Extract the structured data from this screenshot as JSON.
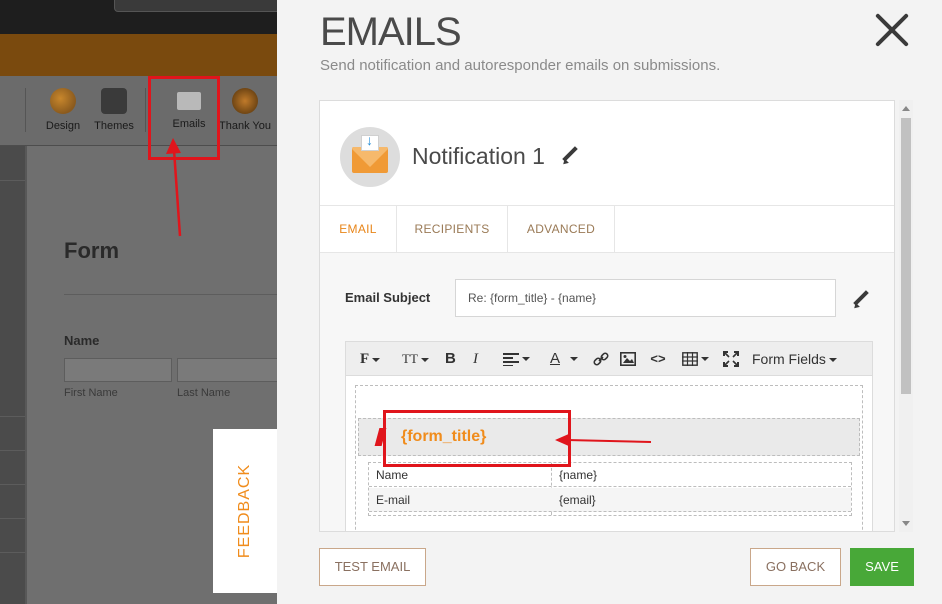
{
  "background_builder": {
    "toolbar": {
      "items": [
        {
          "label": "Design",
          "icon": "palette-icon"
        },
        {
          "label": "Themes",
          "icon": "paint-bucket-icon"
        },
        {
          "label": "Emails",
          "icon": "email-icon"
        },
        {
          "label": "Thank You",
          "icon": "thank-you-icon"
        }
      ]
    },
    "form": {
      "title": "Form",
      "field_label": "Name",
      "first_name": "First Name",
      "last_name": "Last Name"
    },
    "feedback_label": "FEEDBACK",
    "colors": {
      "highlight": "#e0151c",
      "feedback_text": "#f08c1c"
    }
  },
  "modal": {
    "title": "EMAILS",
    "subtitle": "Send notification and autoresponder emails on submissions.",
    "close_icon": "close-icon",
    "notification": {
      "name": "Notification 1",
      "icon": "email-notification-icon",
      "edit_icon": "pencil-icon"
    },
    "tabs": [
      {
        "label": "EMAIL",
        "active": true
      },
      {
        "label": "RECIPIENTS",
        "active": false
      },
      {
        "label": "ADVANCED",
        "active": false
      }
    ],
    "email_subject": {
      "label": "Email Subject",
      "value": "Re: {form_title} - {name}"
    },
    "editor": {
      "toolbar": {
        "font_family": "F",
        "font_size": "TT",
        "bold": "B",
        "italic": "I",
        "align_icon": "align-left-icon",
        "text_color": "A",
        "link_icon": "link-icon",
        "image_icon": "image-icon",
        "code_icon": "code-icon",
        "table_icon": "table-icon",
        "fullscreen_icon": "fullscreen-icon",
        "form_fields_label": "Form Fields"
      },
      "content": {
        "title": "{form_title}",
        "rows": [
          {
            "label": "Name",
            "value": "{name}"
          },
          {
            "label": "E-mail",
            "value": "{email}"
          }
        ]
      }
    },
    "buttons": {
      "test_email": "TEST EMAIL",
      "go_back": "GO BACK",
      "save": "SAVE"
    },
    "colors": {
      "accent": "#e8861a",
      "save": "#48a838",
      "title_text": "#4a4a4a"
    }
  }
}
